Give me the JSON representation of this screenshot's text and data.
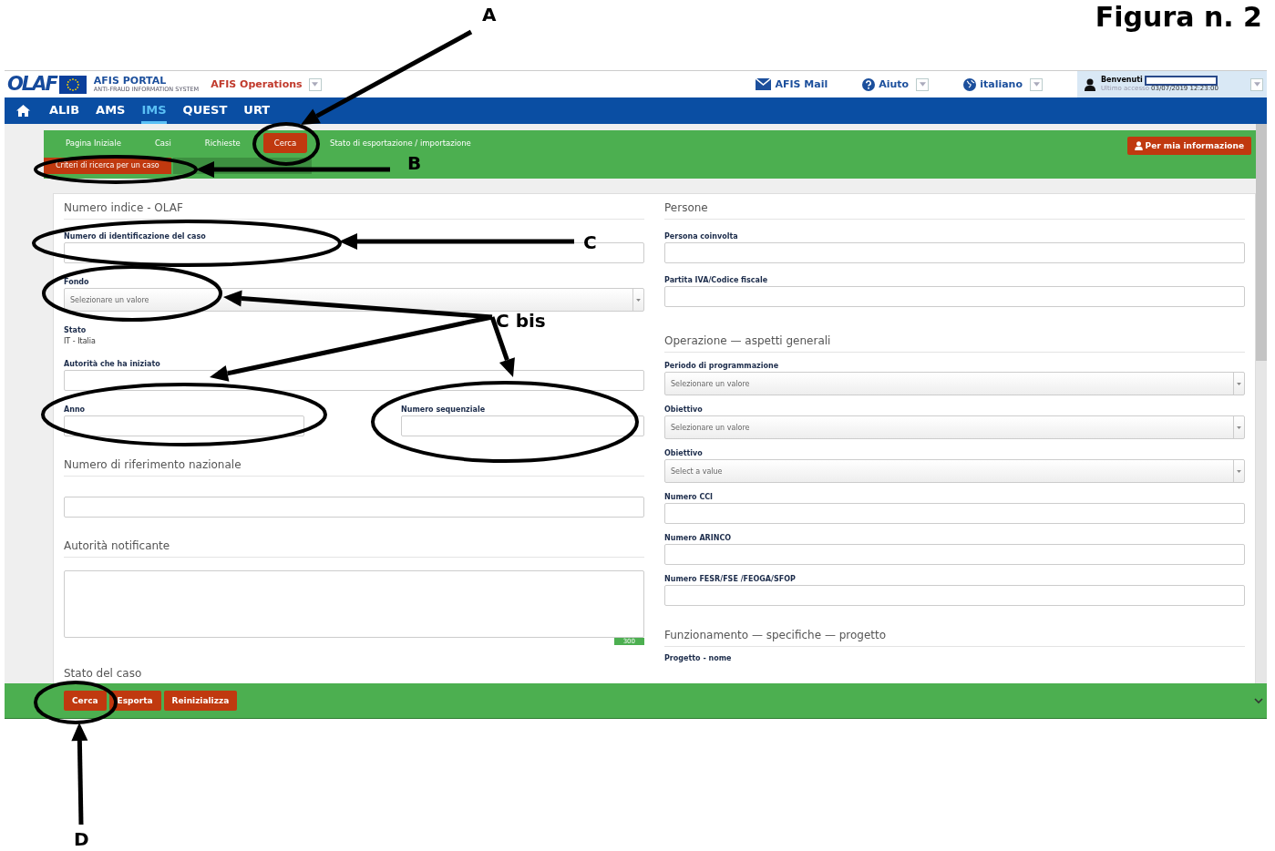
{
  "figure_caption": "Figura n. 2",
  "annotations": [
    "A",
    "B",
    "C",
    "C bis",
    "D"
  ],
  "header": {
    "logo": "OLAF",
    "portal_title": "AFIS PORTAL",
    "portal_subtitle": "ANTI-FRAUD INFORMATION SYSTEM",
    "app": "AFIS Operations",
    "links": [
      {
        "kind": "mail",
        "label": "AFIS Mail"
      },
      {
        "kind": "help",
        "label": "Aiuto"
      },
      {
        "kind": "language",
        "label": "italiano"
      }
    ],
    "user": {
      "greeting": "Benvenuti",
      "last_access_label": "Ultimo accesso",
      "last_access": "03/07/2019 12:23:00"
    }
  },
  "nav": [
    {
      "label": "ALIB",
      "selected": false
    },
    {
      "label": "AMS",
      "selected": false
    },
    {
      "label": "IMS",
      "selected": true
    },
    {
      "label": "QUEST",
      "selected": false
    },
    {
      "label": "URT",
      "selected": false
    }
  ],
  "tabs": [
    {
      "label": "Pagina Iniziale",
      "selected": false
    },
    {
      "label": "Casi",
      "selected": false
    },
    {
      "label": "Richieste",
      "selected": false
    },
    {
      "label": "Cerca",
      "selected": true
    },
    {
      "label": "Stato di esportazione / importazione",
      "selected": false
    }
  ],
  "info_button": "Per mia informazione",
  "subtabs": [
    {
      "label": "Criteri di ricerca per un caso",
      "selected": true
    },
    {
      "selected": false
    }
  ],
  "left_sections": [
    {
      "heading": "Numero indice - OLAF",
      "fields": [
        {
          "kind": "text",
          "label": "Numero di identificazione del caso"
        },
        {
          "kind": "select",
          "label": "Fondo",
          "placeholder": "Selezionare un valore"
        },
        {
          "kind": "static",
          "label": "Stato",
          "value": "IT - Italia"
        },
        {
          "kind": "text",
          "label": "Autorità che ha iniziato"
        },
        {
          "kind": "pair",
          "items": [
            {
              "label": "Anno"
            },
            {
              "label": "Numero sequenziale"
            }
          ]
        }
      ]
    },
    {
      "heading": "Numero di riferimento nazionale",
      "fields": [
        {
          "kind": "text"
        }
      ]
    },
    {
      "heading": "Autorità notificante",
      "fields": [
        {
          "kind": "textarea",
          "counter": "300"
        }
      ]
    },
    {
      "heading": "Stato del caso"
    }
  ],
  "right_sections": [
    {
      "heading": "Persone",
      "fields": [
        {
          "kind": "text",
          "label": "Persona coinvolta"
        },
        {
          "kind": "text",
          "label": "Partita IVA/Codice fiscale"
        }
      ]
    },
    {
      "heading": "Operazione — aspetti generali",
      "fields": [
        {
          "kind": "select",
          "label": "Periodo di programmazione",
          "placeholder": "Selezionare un valore"
        },
        {
          "kind": "select",
          "label": "Obiettivo",
          "placeholder": "Selezionare un valore"
        },
        {
          "kind": "select",
          "label": "Obiettivo",
          "placeholder": "Select a value"
        },
        {
          "kind": "text",
          "label": "Numero CCI"
        },
        {
          "kind": "text",
          "label": "Numero ARINCO"
        },
        {
          "kind": "text",
          "label": "Numero FESR/FSE /FEOGA/SFOP"
        }
      ]
    },
    {
      "heading": "Funzionamento — specifiche — progetto",
      "fields": [
        {
          "kind": "label",
          "label": "Progetto - nome"
        }
      ]
    }
  ],
  "actions": [
    "Cerca",
    "Esporta",
    "Reinizializza"
  ]
}
